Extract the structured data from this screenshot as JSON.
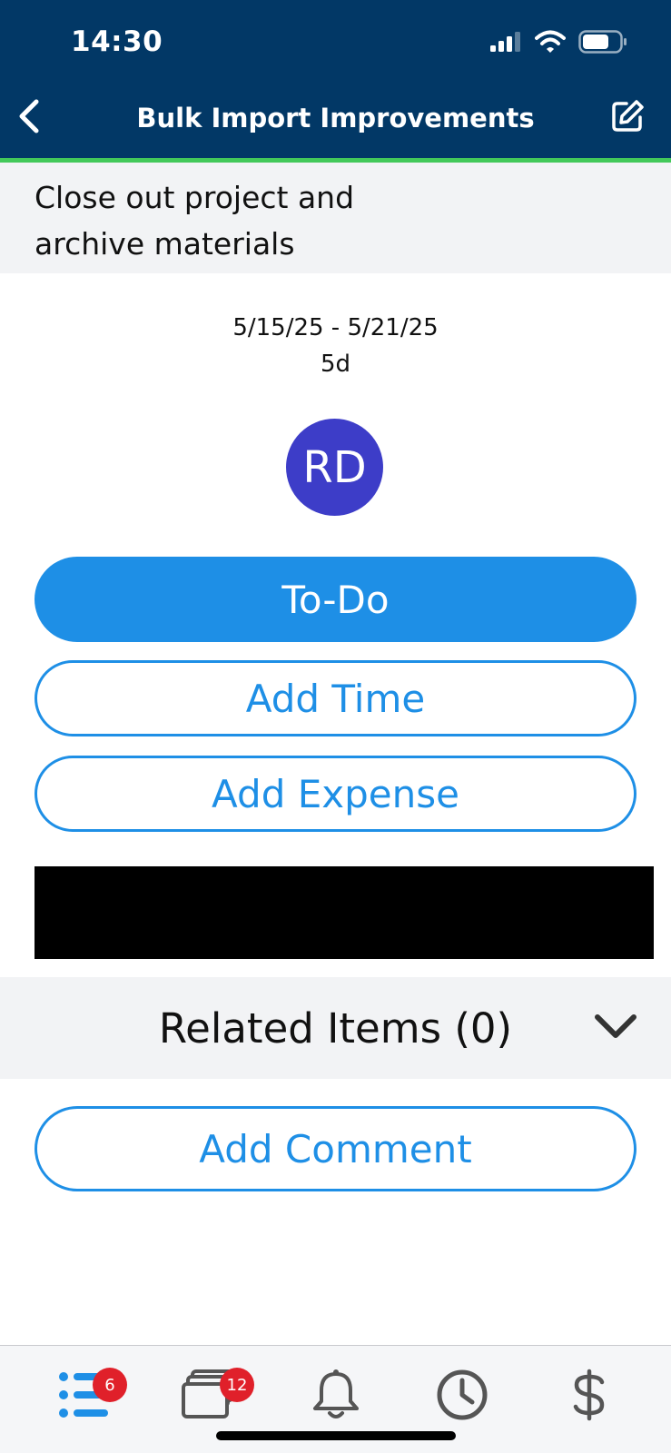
{
  "status_bar": {
    "time": "14:30",
    "icons": [
      "cellular-signal-icon",
      "wifi-icon",
      "battery-icon"
    ]
  },
  "nav": {
    "title": "Bulk Import Improvements",
    "back_icon": "chevron-left-icon",
    "edit_icon": "edit-icon"
  },
  "task": {
    "title": "Close out project and archive materials",
    "date_range": "5/15/25 - 5/21/25",
    "duration": "5d",
    "assignee_initials": "RD"
  },
  "actions": {
    "status_label": "To-Do",
    "add_time_label": "Add Time",
    "add_expense_label": "Add Expense",
    "add_comment_label": "Add Comment"
  },
  "related": {
    "label": "Related Items (0)",
    "icon": "chevron-down-icon"
  },
  "tabbar": {
    "tabs": [
      {
        "icon": "list-icon",
        "badge": "6",
        "active": true
      },
      {
        "icon": "cards-icon",
        "badge": "12",
        "active": false
      },
      {
        "icon": "bell-icon",
        "badge": "",
        "active": false
      },
      {
        "icon": "clock-icon",
        "badge": "",
        "active": false
      },
      {
        "icon": "dollar-icon",
        "badge": "",
        "active": false
      }
    ]
  },
  "colors": {
    "header": "#023866",
    "header_accent": "#43c95a",
    "primary": "#1e8fe6",
    "avatar": "#3d3dc8",
    "badge": "#e0202a"
  }
}
